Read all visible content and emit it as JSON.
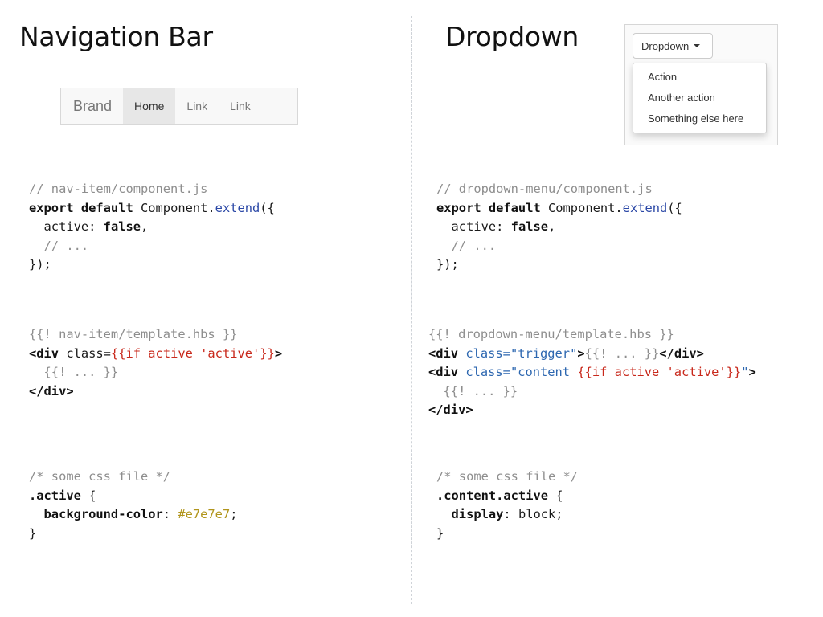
{
  "sections": {
    "left_title": "Navigation Bar",
    "right_title": "Dropdown"
  },
  "navbar_demo": {
    "brand": "Brand",
    "items": [
      {
        "label": "Home",
        "active": true
      },
      {
        "label": "Link",
        "active": false
      },
      {
        "label": "Link",
        "active": false
      }
    ],
    "active_bg": "#e7e7e7"
  },
  "dropdown_demo": {
    "button_label": "Dropdown",
    "menu_items": [
      "Action",
      "Another action",
      "Something else here"
    ]
  },
  "code": {
    "nav_js": {
      "comment": "// nav-item/component.js",
      "kw_export": "export default",
      "component": " Component.",
      "method": "extend",
      "open": "({",
      "prop": "  active: ",
      "value": "false",
      "comma": ",",
      "ellipsis": "  // ...",
      "close": "});"
    },
    "nav_hbs": {
      "comment": "{{! nav-item/template.hbs }}",
      "open_tag": "<div",
      "class_attr": " class=",
      "helper": "{{if active 'active'}}",
      "close_bracket": ">",
      "body": "  {{! ... }}",
      "end_tag": "</div>"
    },
    "nav_css": {
      "comment": "/* some css file */",
      "selector": ".active",
      "brace_open": " {",
      "property": "  background-color",
      "colon": ": ",
      "value": "#e7e7e7",
      "semicolon": ";",
      "brace_close": "}"
    },
    "dd_js": {
      "comment": "// dropdown-menu/component.js",
      "kw_export": "export default",
      "component": " Component.",
      "method": "extend",
      "open": "({",
      "prop": "  active: ",
      "value": "false",
      "comma": ",",
      "ellipsis": "  // ...",
      "close": "});"
    },
    "dd_hbs": {
      "comment": "{{! dropdown-menu/template.hbs }}",
      "line1_tag": "<div",
      "line1_attr": " class=\"trigger\"",
      "line1_gt": ">",
      "line1_body": "{{! ... }}",
      "line1_end": "</div>",
      "line2_tag": "<div",
      "line2_attr": " class=\"content ",
      "line2_helper": "{{if active 'active'}}",
      "line2_quote": "\"",
      "line2_gt": ">",
      "body": "  {{! ... }}",
      "end_tag": "</div>"
    },
    "dd_css": {
      "comment": "/* some css file */",
      "selector": ".content.active",
      "brace_open": " {",
      "property": "  display",
      "colon": ": ",
      "value": "block",
      "semicolon": ";",
      "brace_close": "}"
    }
  }
}
